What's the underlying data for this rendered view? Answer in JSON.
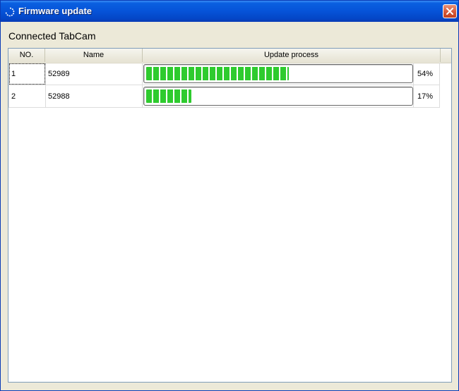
{
  "window": {
    "title": "Firmware update",
    "icon": "refresh-icon"
  },
  "section_label": "Connected TabCam",
  "columns": [
    "NO.",
    "Name",
    "Update process"
  ],
  "rows": [
    {
      "no": "1",
      "name": "52989",
      "progress": 0.54,
      "percent": "54%"
    },
    {
      "no": "2",
      "name": "52988",
      "progress": 0.17,
      "percent": "17%"
    }
  ],
  "colors": {
    "progress_fill": "#2ecb2e",
    "title_bar": "#0653d8"
  }
}
